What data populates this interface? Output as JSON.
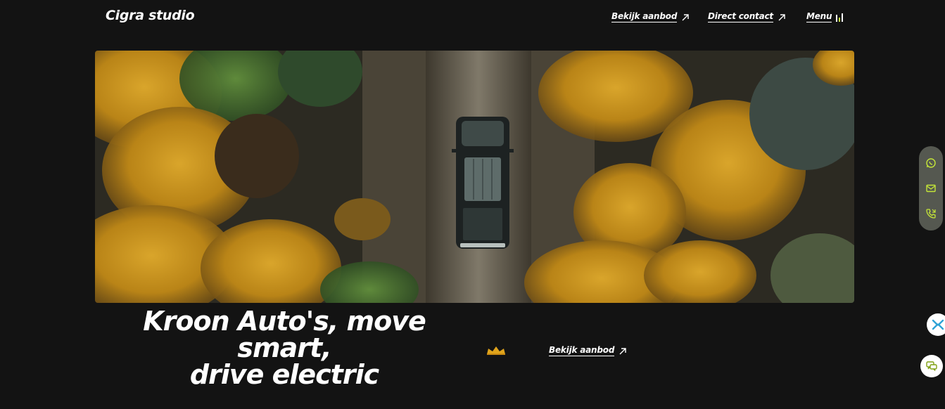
{
  "header": {
    "logo": "Cigra studio",
    "nav": [
      {
        "label": "Bekijk aanbod"
      },
      {
        "label": "Direct contact"
      },
      {
        "label": "Menu"
      }
    ]
  },
  "hero": {
    "image_alt": "aerial photo of a dark pickup truck on a dirt track through autumn forest",
    "headline_line1": "Kroon Auto's, move smart,",
    "headline_line2": "drive electric",
    "cta_label": "Bekijk aanbod"
  },
  "side_contact": {
    "icons": [
      "whatsapp-icon",
      "mail-icon",
      "phone-icon"
    ]
  },
  "floating_buttons": [
    "bird-logo-icon",
    "chat-icon"
  ],
  "colors": {
    "background": "#131313",
    "accent": "#c4e538",
    "crown": "#e0a41c"
  }
}
